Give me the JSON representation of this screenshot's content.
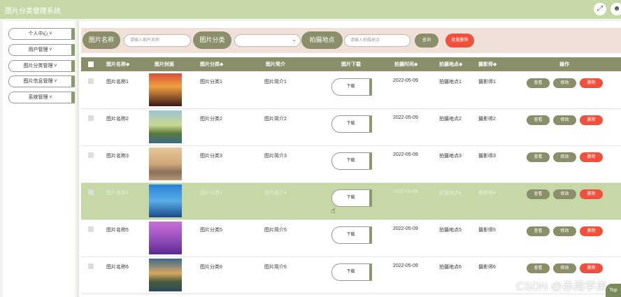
{
  "app": {
    "title": "图片分类管理系统"
  },
  "header_icons": [
    "fullscreen-icon",
    "user-icon"
  ],
  "sidebar": {
    "items": [
      {
        "label": "个人中心 ˅"
      },
      {
        "label": "用户管理 ˅"
      },
      {
        "label": "图片分类管理 ˅"
      },
      {
        "label": "图片信息管理 ˅"
      },
      {
        "label": "系统管理 ˅"
      }
    ]
  },
  "search": {
    "name_label": "图片名称",
    "name_placeholder": "请输入图片名称",
    "category_label": "图片分类",
    "category_value": "",
    "location_label": "拍摄地点",
    "location_placeholder": "请输入拍摄地点",
    "query_button": "查询",
    "batch_delete_button": "批量删除"
  },
  "table": {
    "headers": [
      "图片名称◆",
      "图片封面",
      "图片分类◆",
      "图片简介",
      "图片下载",
      "拍摄时间◆",
      "拍摄地点◆",
      "摄影师◆",
      "操作"
    ],
    "download_label": "下载",
    "actions": {
      "view": "查看",
      "edit": "修改",
      "delete": "删除"
    },
    "highlighted_row": 4,
    "rows": [
      {
        "name": "图片名称1",
        "category": "图片分类1",
        "intro": "图片简介1",
        "time": "2022-05-09",
        "location": "拍摄地点1",
        "photographer": "摄影师1",
        "cover": "sunset-sea"
      },
      {
        "name": "图片名称2",
        "category": "图片分类2",
        "intro": "图片简介2",
        "time": "2022-05-09",
        "location": "拍摄地点2",
        "photographer": "摄影师2",
        "cover": "lake-tree"
      },
      {
        "name": "图片名称3",
        "category": "图片分类3",
        "intro": "图片简介3",
        "time": "2022-05-09",
        "location": "拍摄地点3",
        "photographer": "摄影师3",
        "cover": "misty-lake"
      },
      {
        "name": "图片名称4",
        "category": "图片分类4",
        "intro": "图片简介4",
        "time": "2022-05-09",
        "location": "拍摄地点4",
        "photographer": "摄影师4",
        "cover": "blue-pier"
      },
      {
        "name": "图片名称5",
        "category": "图片分类5",
        "intro": "图片简介5",
        "time": "2022-05-09",
        "location": "拍摄地点5",
        "photographer": "摄影师5",
        "cover": "purple-field"
      },
      {
        "name": "图片名称6",
        "category": "图片分类6",
        "intro": "图片简介6",
        "time": "2022-05-09",
        "location": "拍摄地点6",
        "photographer": "摄影师6",
        "cover": "boat-lake"
      }
    ]
  },
  "colors": {
    "topbar": "#c6d8a5",
    "accent": "#8a8f6a",
    "danger": "#f0503c",
    "search_bg": "#efe0d8",
    "row_highlight": "#c6d8a5"
  },
  "watermark": "CSDN @赤南学弟",
  "back_to_top": "Top"
}
